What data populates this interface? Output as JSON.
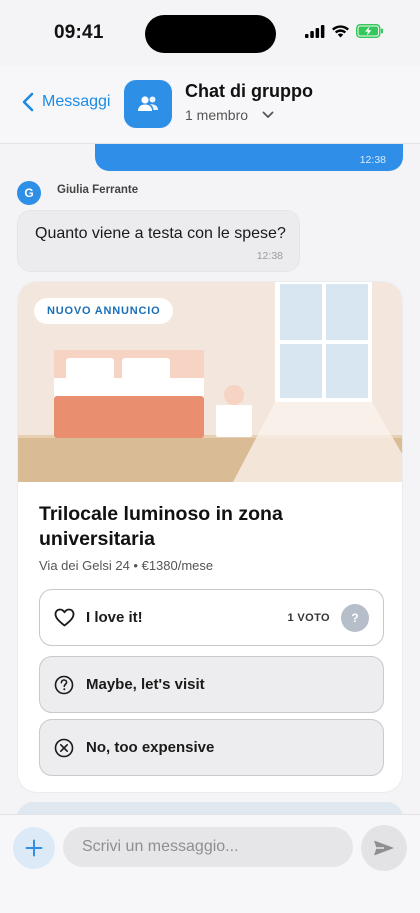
{
  "status_bar": {
    "time": "09:41",
    "icons": [
      "cellular-signal-icon",
      "wifi-icon",
      "battery-charging-icon"
    ]
  },
  "header": {
    "back_label": "Messaggi",
    "title": "Chat di gruppo",
    "members": "1 membro",
    "avatar_icon": "group-icon"
  },
  "chat": {
    "own_message_time": "12:38",
    "incoming": {
      "avatar_initial": "G",
      "sender": "Giulia Ferrante",
      "text": "Quanto viene a testa con le spese?",
      "time": "12:38"
    },
    "listing": {
      "badge": "NUOVO ANNUNCIO",
      "title": "Trilocale luminoso in zona universitaria",
      "subtitle": "Via dei Gelsi 24 • €1380/mese",
      "options": [
        {
          "label": "I love it!",
          "votes": "1 VOTO",
          "voter_initial": "?",
          "icon": "heart-icon",
          "selected": true
        },
        {
          "label": "Maybe, let's visit",
          "icon": "question-circle-icon",
          "selected": false
        },
        {
          "label": "No, too expensive",
          "icon": "x-circle-icon",
          "selected": false
        }
      ]
    }
  },
  "composer": {
    "placeholder": "Scrivi un messaggio...",
    "value": ""
  },
  "colors": {
    "accent": "#2f8fe8",
    "badge_text": "#1a6fb8",
    "bed_blanket": "#e98f70",
    "wall": "#f3e5dc",
    "floor": "#d9bb96",
    "window": "#d8e6f1"
  }
}
